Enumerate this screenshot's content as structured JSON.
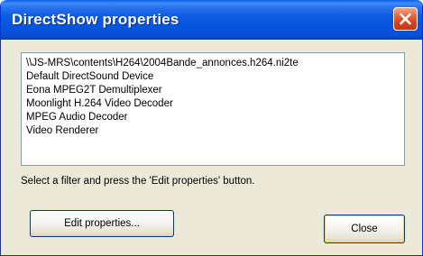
{
  "window": {
    "title": "DirectShow properties"
  },
  "filters": {
    "items": [
      "\\\\JS-MRS\\contents\\H264\\2004Bande_annonces.h264.ni2te",
      "Default DirectSound Device",
      "Eona MPEG2T Demultiplexer",
      "Moonlight H.264 Video Decoder",
      "MPEG Audio Decoder",
      "Video Renderer"
    ]
  },
  "hint": "Select a filter and press the 'Edit properties' button.",
  "buttons": {
    "edit": "Edit properties...",
    "close": "Close"
  },
  "colors": {
    "titlebar": "#0a5ee8",
    "dialog_bg": "#ece9d8",
    "close_button": "#d8441d"
  },
  "icons": {
    "close": "close-icon"
  }
}
